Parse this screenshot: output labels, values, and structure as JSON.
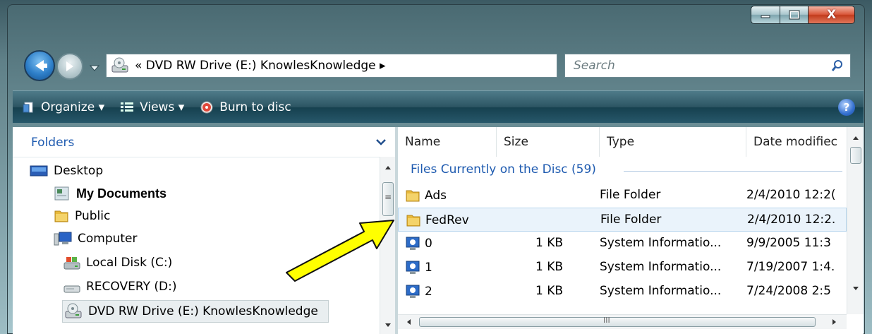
{
  "window": {
    "controls": {
      "minimize_icon": "minimize-icon",
      "maximize_icon": "maximize-icon",
      "close_glyph": "X"
    }
  },
  "address_bar": {
    "path_text": "« DVD RW Drive (E:) KnowlesKnowledge ▸",
    "drive_icon": "optical-drive-icon",
    "dropdown_glyph": "▾",
    "refresh_glyph": "↻"
  },
  "search": {
    "placeholder": "Search"
  },
  "toolbar": {
    "organize_label": "Organize ▾",
    "views_label": "Views ▾",
    "burn_label": "Burn to disc",
    "help_glyph": "?"
  },
  "folders_panel": {
    "title": "Folders",
    "items": [
      {
        "label": "Desktop",
        "icon": "desktop-icon"
      },
      {
        "label": "My Documents",
        "icon": "documents-icon"
      },
      {
        "label": "Public",
        "icon": "folder-icon"
      },
      {
        "label": "Computer",
        "icon": "computer-icon"
      },
      {
        "label": "Local Disk (C:)",
        "icon": "hard-disk-icon"
      },
      {
        "label": "RECOVERY (D:)",
        "icon": "drive-icon"
      },
      {
        "label": "DVD RW Drive (E:) KnowlesKnowledge",
        "icon": "optical-drive-icon"
      }
    ]
  },
  "file_list": {
    "columns": [
      "Name",
      "Size",
      "Type",
      "Date modifiec"
    ],
    "group_label": "Files Currently on the Disc (59)",
    "rows": [
      {
        "name": "Ads",
        "size": "",
        "type": "File Folder",
        "date": "2/4/2010 12:2(",
        "icon": "folder-icon"
      },
      {
        "name": "FedRev",
        "size": "",
        "type": "File Folder",
        "date": "2/4/2010 12:2.",
        "icon": "folder-icon"
      },
      {
        "name": "0",
        "size": "1 KB",
        "type": "System Informatio...",
        "date": "9/9/2005 11:3",
        "icon": "system-info-icon"
      },
      {
        "name": "1",
        "size": "1 KB",
        "type": "System Informatio...",
        "date": "7/19/2007 1:4.",
        "icon": "system-info-icon"
      },
      {
        "name": "2",
        "size": "1 KB",
        "type": "System Informatio...",
        "date": "7/24/2008 2:5",
        "icon": "system-info-icon"
      }
    ],
    "selected_row": "FedRev"
  },
  "annotation": {
    "arrow_color": "#ffff00",
    "points_to": "FedRev"
  },
  "scrollbars": {
    "left_grip": "≡",
    "h_grip": "III"
  }
}
